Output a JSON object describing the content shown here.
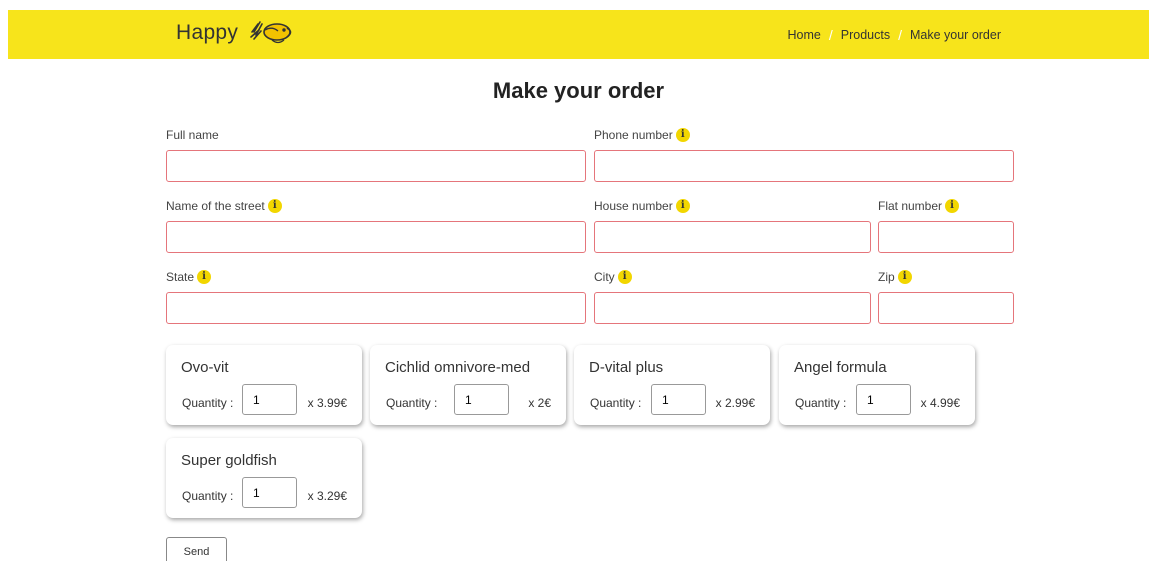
{
  "header": {
    "brand": "Happy",
    "breadcrumb": [
      "Home",
      "Products",
      "Make your order"
    ],
    "color": "#f7e41b"
  },
  "title": "Make your order",
  "form": {
    "full_name": {
      "label": "Full name",
      "value": ""
    },
    "phone": {
      "label": "Phone number",
      "value": ""
    },
    "street": {
      "label": "Name of the street",
      "value": ""
    },
    "house": {
      "label": "House number",
      "value": ""
    },
    "flat": {
      "label": "Flat number",
      "value": ""
    },
    "state": {
      "label": "State",
      "value": ""
    },
    "city": {
      "label": "City",
      "value": ""
    },
    "zip": {
      "label": "Zip",
      "value": ""
    },
    "invalid_border_color": "#e5757b",
    "info_icon": "i"
  },
  "products": [
    {
      "name": "Ovo-vit",
      "quantity_label": "Quantity :",
      "quantity": "1",
      "price": "x 3.99€"
    },
    {
      "name": "Cichlid omnivore-med",
      "quantity_label": "Quantity :",
      "quantity": "1",
      "price": "x 2€"
    },
    {
      "name": "D-vital plus",
      "quantity_label": "Quantity :",
      "quantity": "1",
      "price": "x 2.99€"
    },
    {
      "name": "Angel formula",
      "quantity_label": "Quantity :",
      "quantity": "1",
      "price": "x 4.99€"
    },
    {
      "name": "Super goldfish",
      "quantity_label": "Quantity :",
      "quantity": "1",
      "price": "x 3.29€"
    }
  ],
  "send_label": "Send"
}
